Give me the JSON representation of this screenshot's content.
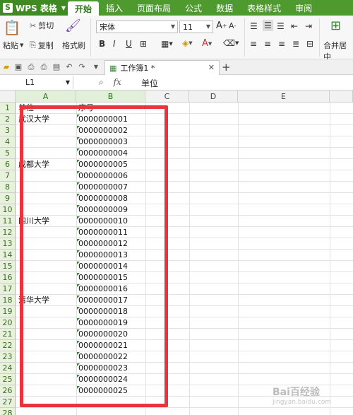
{
  "app": {
    "name": "WPS 表格"
  },
  "menu": {
    "tabs": [
      "开始",
      "插入",
      "页面布局",
      "公式",
      "数据",
      "表格样式",
      "审阅"
    ],
    "active_index": 0
  },
  "ribbon": {
    "cut": "剪切",
    "copy": "复制",
    "format_painter": "格式刷",
    "paste": "粘贴",
    "font_name": "宋体",
    "font_size": "11",
    "bold": "B",
    "italic": "I",
    "underline": "U",
    "merge_center": "合并居中"
  },
  "doc_tab": {
    "title": "工作簿1 *"
  },
  "formula_bar": {
    "cell_ref": "L1",
    "fx": "fx",
    "content": "单位"
  },
  "grid": {
    "columns": [
      "A",
      "B",
      "C",
      "D",
      "E"
    ],
    "rows": [
      "1",
      "2",
      "3",
      "4",
      "5",
      "6",
      "7",
      "8",
      "9",
      "10",
      "11",
      "12",
      "13",
      "14",
      "15",
      "16",
      "17",
      "18",
      "19",
      "20",
      "21",
      "22",
      "23",
      "24",
      "25",
      "26",
      "27",
      "28"
    ],
    "col_a": [
      "单位",
      "武汉大学",
      "",
      "",
      "",
      "成都大学",
      "",
      "",
      "",
      "",
      "四川大学",
      "",
      "",
      "",
      "",
      "",
      "",
      "清华大学",
      "",
      "",
      "",
      "",
      "",
      "",
      "",
      "",
      "",
      ""
    ],
    "col_b": [
      "序号",
      "0000000001",
      "0000000002",
      "0000000003",
      "0000000004",
      "0000000005",
      "0000000006",
      "0000000007",
      "0000000008",
      "0000000009",
      "0000000010",
      "0000000011",
      "0000000012",
      "0000000013",
      "0000000014",
      "0000000015",
      "0000000016",
      "0000000017",
      "0000000018",
      "0000000019",
      "0000000020",
      "0000000021",
      "0000000022",
      "0000000023",
      "0000000024",
      "0000000025",
      "",
      ""
    ]
  },
  "watermark": {
    "text": "Bai百经验",
    "sub": "jingyan.baidu.com"
  },
  "colors": {
    "accent": "#4e9a2f",
    "highlight_box": "#e8343d",
    "text_marker": "#2f8a2f"
  }
}
